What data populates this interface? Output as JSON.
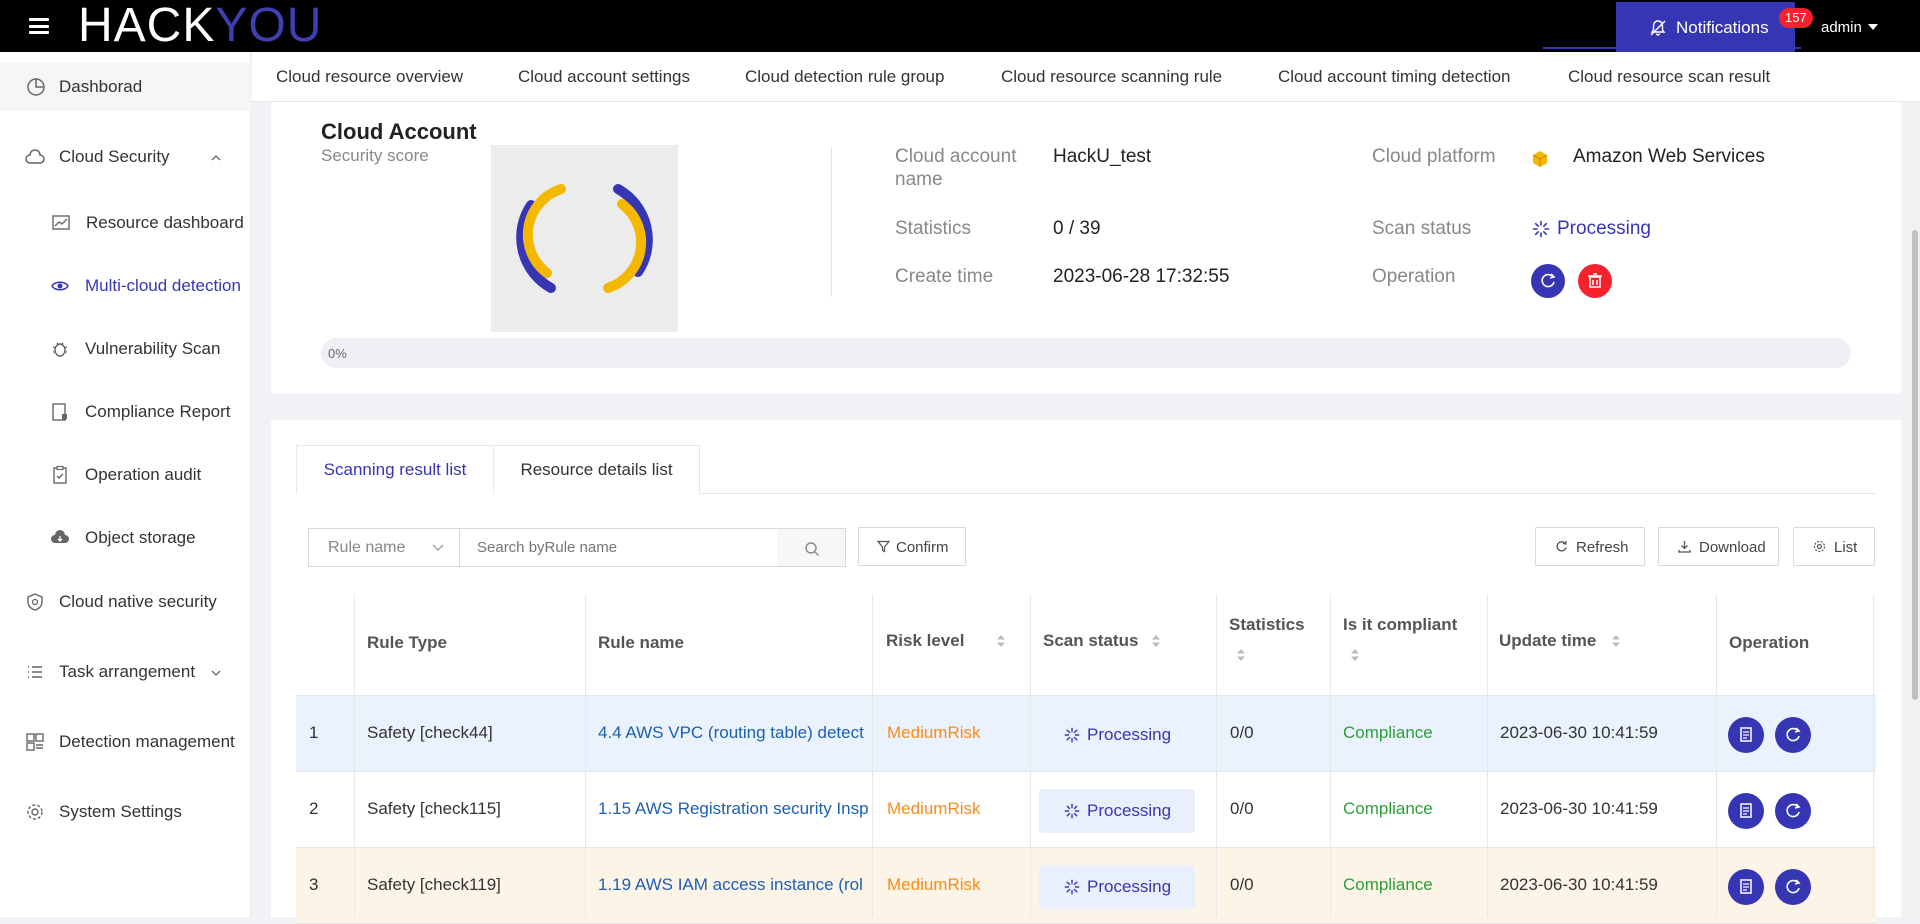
{
  "topbar": {
    "logo_hack": "HACK",
    "logo_you": "YOU",
    "notifications_label": "Notifications",
    "notifications_count": "157",
    "user": "admin"
  },
  "sidebar": {
    "items": [
      {
        "label": "Dashborad",
        "icon": "dashboard-icon"
      },
      {
        "label": "Cloud Security",
        "icon": "cloud-icon"
      },
      {
        "label": "Resource dashboard",
        "icon": "chart-icon"
      },
      {
        "label": "Multi-cloud detection",
        "icon": "eye-icon"
      },
      {
        "label": "Vulnerability Scan",
        "icon": "bug-icon"
      },
      {
        "label": "Compliance Report",
        "icon": "report-icon"
      },
      {
        "label": "Operation audit",
        "icon": "audit-icon"
      },
      {
        "label": "Object storage",
        "icon": "cloud-storage-icon"
      },
      {
        "label": "Cloud native security",
        "icon": "shield-icon"
      },
      {
        "label": "Task arrangement",
        "icon": "list-icon"
      },
      {
        "label": "Detection management",
        "icon": "grid-icon"
      },
      {
        "label": "System Settings",
        "icon": "gear-icon"
      }
    ]
  },
  "tabs": [
    "Cloud resource overview",
    "Cloud account settings",
    "Cloud detection rule group",
    "Cloud resource scanning rule",
    "Cloud account timing detection",
    "Cloud resource scan result"
  ],
  "account": {
    "title": "Cloud Account",
    "score_label": "Security score",
    "fields": {
      "name_key": "Cloud account name",
      "name_val": "HackU_test",
      "stats_key": "Statistics",
      "stats_val": "0 / 39",
      "create_key": "Create time",
      "create_val": "2023-06-28 17:32:55",
      "platform_key": "Cloud platform",
      "platform_val": "Amazon Web Services",
      "scan_key": "Scan status",
      "scan_val": "Processing",
      "op_key": "Operation"
    },
    "progress_text": "0%",
    "progress_value": 0
  },
  "results": {
    "tabs": [
      "Scanning result list",
      "Resource details list"
    ],
    "filter": {
      "select_value": "Rule name",
      "search_placeholder": "Search byRule name",
      "confirm": "Confirm",
      "refresh": "Refresh",
      "download": "Download",
      "list": "List"
    },
    "columns": [
      "Rule Type",
      "Rule name",
      "Risk level",
      "Scan status",
      "Statistics",
      "Is it compliant",
      "Update time",
      "Operation"
    ],
    "rows": [
      {
        "idx": "1",
        "type": "Safety [check44]",
        "name": "4.4 AWS VPC (routing table) detect",
        "risk": "MediumRisk",
        "status": "Processing",
        "stats": "0/0",
        "compliant": "Compliance",
        "time": "2023-06-30 10:41:59"
      },
      {
        "idx": "2",
        "type": "Safety [check115]",
        "name": "1.15 AWS Registration security Insp",
        "risk": "MediumRisk",
        "status": "Processing",
        "stats": "0/0",
        "compliant": "Compliance",
        "time": "2023-06-30 10:41:59"
      },
      {
        "idx": "3",
        "type": "Safety [check119]",
        "name": "1.19 AWS IAM access instance (rol",
        "risk": "MediumRisk",
        "status": "Processing",
        "stats": "0/0",
        "compliant": "Compliance",
        "time": "2023-06-30 10:41:59"
      }
    ]
  },
  "colors": {
    "accent": "#3636b5",
    "danger": "#f5222d",
    "risk": "#fa8c16",
    "ok": "#2e9e3a",
    "gauge_yellow": "#f5b800"
  }
}
